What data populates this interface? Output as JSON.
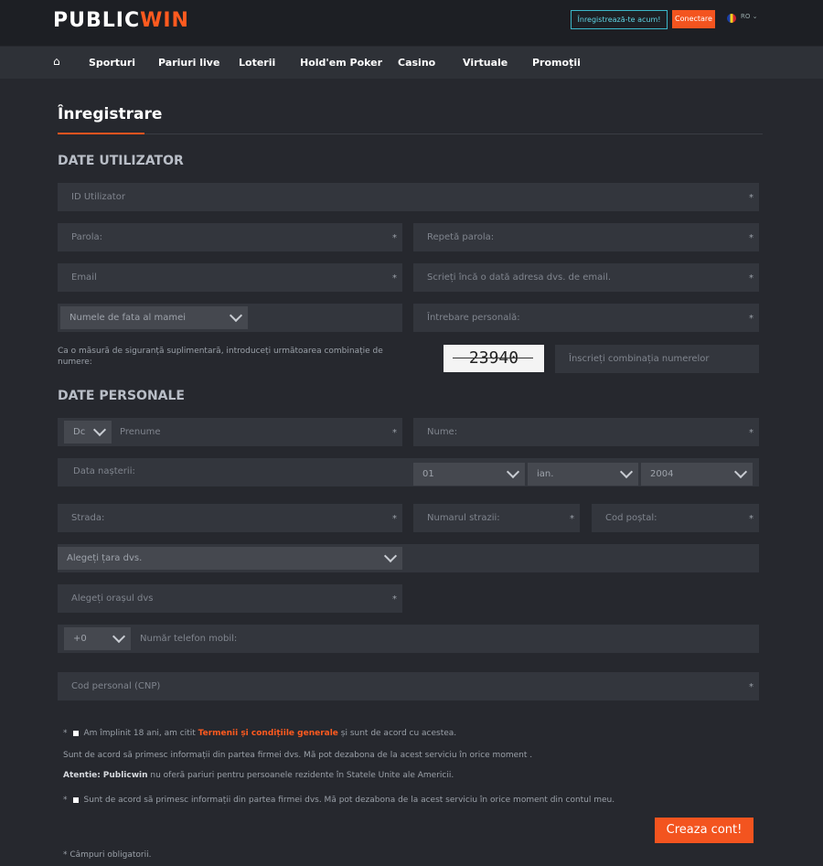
{
  "header": {
    "logo_public": "PUBLIC",
    "logo_win": "WIN",
    "register_button": "Înregistrează-te acum!",
    "login_button": "Conectare",
    "language": "RO ⌄"
  },
  "nav": {
    "items": [
      "Sporturi",
      "Pariuri live",
      "Loterii",
      "Hold'em Poker",
      "Casino",
      "Virtuale",
      "Promoții"
    ]
  },
  "page": {
    "title": "Înregistrare",
    "section_user": "DATE UTILIZATOR",
    "section_personal": "DATE PERSONALE"
  },
  "form": {
    "user_id": "ID Utilizator",
    "password": "Parola:",
    "repeat_password": "Repetă parola:",
    "email": "Email",
    "repeat_email": "Scrieți încă o dată adresa dvs. de email.",
    "security_question_select": "Numele de fata al mamei",
    "personal_question": "Întrebare personală:",
    "captcha_instruction": "Ca o măsură de siguranță suplimentară, introduceți următoarea combinație de numere:",
    "captcha_code": "23940",
    "captcha_input": "Înscrieți combinația numerelor",
    "title_select": "Dc",
    "first_name": "Prenume",
    "last_name": "Nume:",
    "dob_label": "Data nașterii:",
    "dob_day": "01",
    "dob_month": "ian.",
    "dob_year": "2004",
    "street": "Strada:",
    "street_number": "Numarul strazii:",
    "postal_code": "Cod poștal:",
    "country_select": "Alegeți țara dvs.",
    "city": "Alegeți orașul dvs",
    "phone_prefix": "+0",
    "phone": "Număr telefon mobil:",
    "cnp": "Cod personal (CNP)",
    "star": "*"
  },
  "legal": {
    "line1_prefix": "Am împlinit 18 ani, am citit",
    "line1_link": "Termenii și condițiile generale",
    "line1_suffix": "și sunt de acord cu acestea.",
    "line2": "Sunt de acord să primesc informații din partea firmei dvs. Mă pot dezabona de la acest serviciu în orice moment .",
    "line3_label": "Atentie:",
    "line3_brand": "Publicwin",
    "line3_rest": "nu oferă pariuri pentru persoanele rezidente în Statele Unite ale Americii.",
    "line4": "Sunt de acord să primesc informații din partea firmei dvs. Mă pot dezabona de la acest serviciu în orice moment din contul meu.",
    "required_note": "* Câmpuri obligatorii."
  },
  "submit_label": "Creaza cont!"
}
